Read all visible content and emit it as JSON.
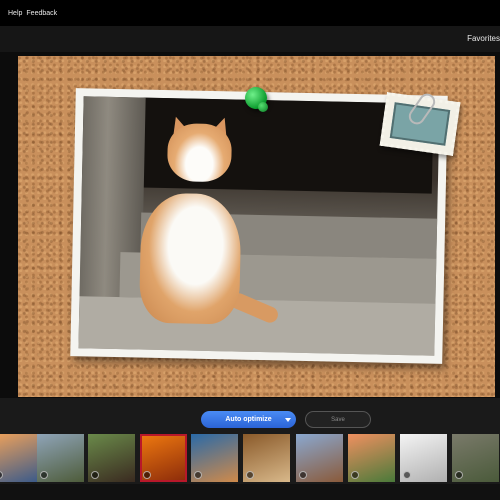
{
  "menu": {
    "help_label": "Help",
    "feedback_label": "Feedback"
  },
  "header": {
    "favorites_label": "Favorites"
  },
  "editor": {
    "small_label": "—",
    "auto_optimize_label": "Auto optimize",
    "save_label": "Save"
  },
  "filmstrip": {
    "selected_index": 3,
    "thumbnails": [
      {
        "name": "sunset-beach",
        "colors": [
          "#f0a25a",
          "#3a5a8a"
        ]
      },
      {
        "name": "tree-landscape",
        "colors": [
          "#8fa4b8",
          "#4e5c3a"
        ]
      },
      {
        "name": "horse-field",
        "colors": [
          "#6a8a4a",
          "#3a2a20"
        ]
      },
      {
        "name": "orange-flower",
        "colors": [
          "#f07a10",
          "#8a2a0a"
        ]
      },
      {
        "name": "coast-sunset",
        "colors": [
          "#2a6aa8",
          "#d08a4a"
        ]
      },
      {
        "name": "nuts-bowl",
        "colors": [
          "#8a5a2a",
          "#d8b88a"
        ]
      },
      {
        "name": "cliff-village",
        "colors": [
          "#8aa8d0",
          "#8a5a3a"
        ]
      },
      {
        "name": "flowers-bouquet",
        "colors": [
          "#f09060",
          "#4a7a3a"
        ]
      },
      {
        "name": "white-abstract",
        "colors": [
          "#f4f4f4",
          "#b0b0b0"
        ]
      },
      {
        "name": "stone-walkway",
        "colors": [
          "#7a7a6a",
          "#4a5a3a"
        ]
      }
    ]
  }
}
